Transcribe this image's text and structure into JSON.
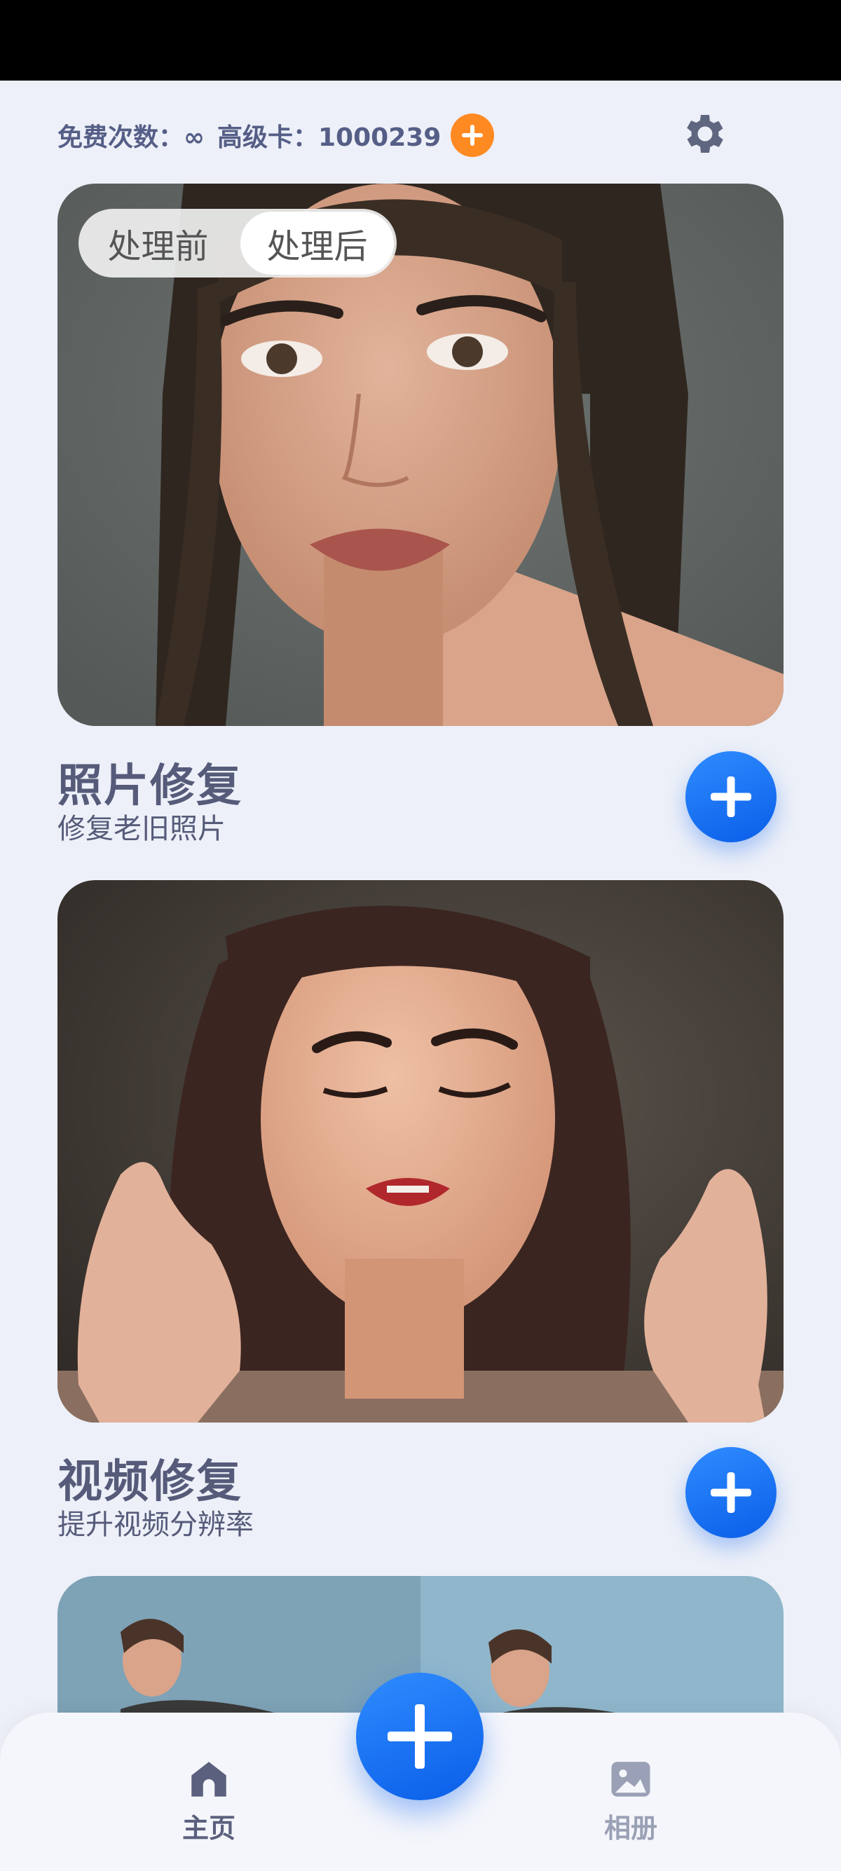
{
  "header": {
    "free_label": "免费次数：∞",
    "premium_label": "高级卡：1000239"
  },
  "photo_card": {
    "toggle_before": "处理前",
    "toggle_after": "处理后",
    "title": "照片修复",
    "subtitle": "修复老旧照片"
  },
  "video_card": {
    "title": "视频修复",
    "subtitle": "提升视频分辨率"
  },
  "tabbar": {
    "home_label": "主页",
    "album_label": "相册"
  },
  "colors": {
    "accent_blue": "#1a73f5",
    "credit_orange": "#ff8a22",
    "text": "#565b7a",
    "background": "#edf0f8"
  },
  "icons": [
    "add-credit-icon",
    "gear-icon",
    "add-icon",
    "home-icon",
    "album-icon"
  ]
}
